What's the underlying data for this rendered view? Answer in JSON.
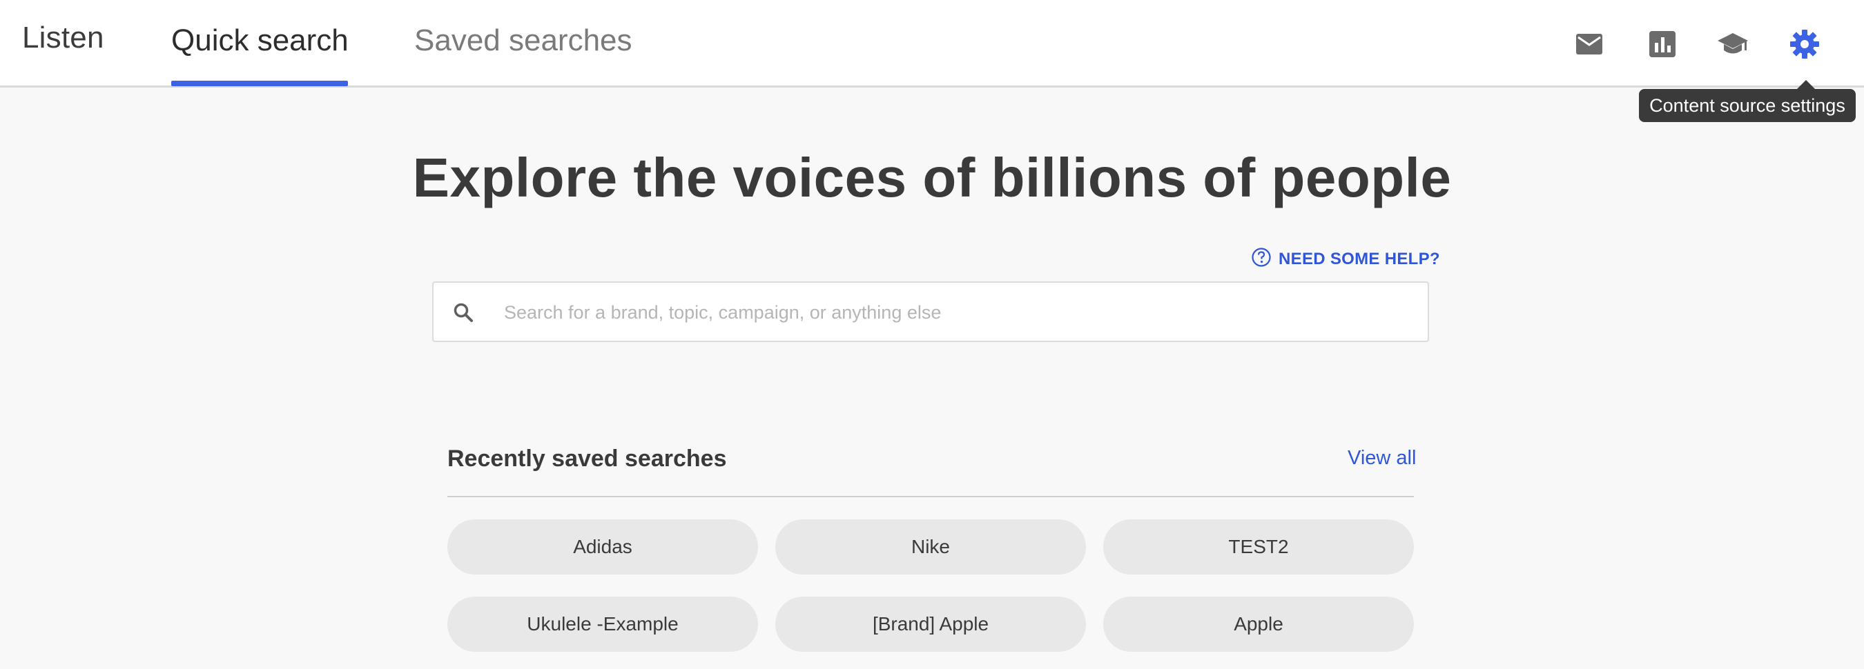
{
  "nav": {
    "app_title": "Listen",
    "tabs": [
      {
        "label": "Quick search",
        "active": true
      },
      {
        "label": "Saved searches",
        "active": false
      }
    ],
    "icons": [
      "mail-icon",
      "chart-icon",
      "graduation-cap-icon",
      "gear-icon"
    ],
    "tooltip": "Content source settings"
  },
  "hero": {
    "title": "Explore the voices of billions of people",
    "help_label": "NEED SOME HELP?",
    "search_placeholder": "Search for a brand, topic, campaign, or anything else"
  },
  "recent": {
    "title": "Recently saved searches",
    "view_all": "View all",
    "items": [
      "Adidas",
      "Nike",
      "TEST2",
      "Ukulele -Example",
      "[Brand] Apple",
      "Apple"
    ]
  },
  "colors": {
    "accent": "#3b63e3",
    "link": "#2f56d8",
    "tooltip_bg": "#3a3a3a",
    "chip_bg": "#e8e8e8"
  }
}
